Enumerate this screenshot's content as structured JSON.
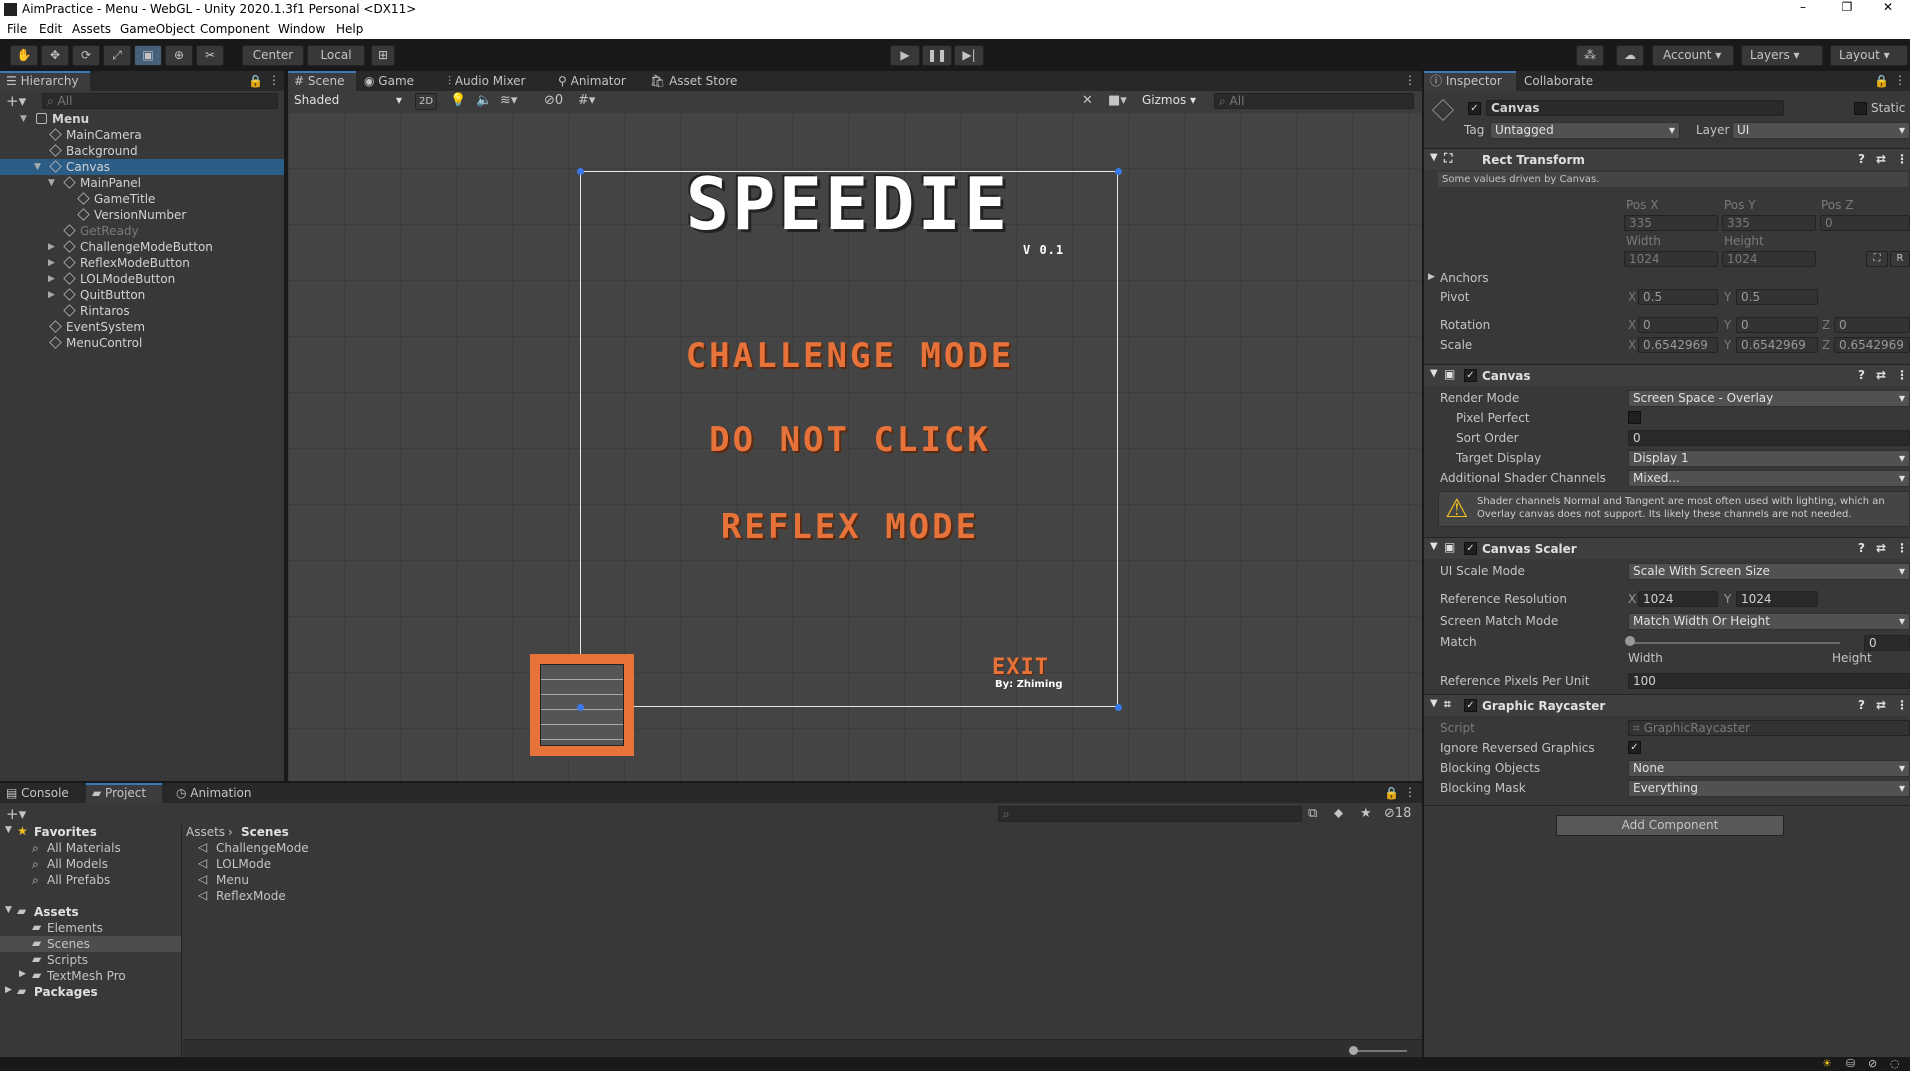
{
  "window": {
    "title": "AimPractice - Menu - WebGL - Unity 2020.1.3f1 Personal <DX11>"
  },
  "menubar": [
    "File",
    "Edit",
    "Assets",
    "GameObject",
    "Component",
    "Window",
    "Help"
  ],
  "toolbar": {
    "center": "Center",
    "local": "Local",
    "account": "Account",
    "layers": "Layers",
    "layout": "Layout"
  },
  "hierarchy": {
    "tab": "Hierarchy",
    "search_placeholder": "All",
    "items": [
      {
        "label": "Menu",
        "depth": 0,
        "expanded": true,
        "scene": true
      },
      {
        "label": "MainCamera",
        "depth": 1
      },
      {
        "label": "Background",
        "depth": 1
      },
      {
        "label": "Canvas",
        "depth": 1,
        "expanded": true,
        "selected": true
      },
      {
        "label": "MainPanel",
        "depth": 2,
        "expanded": true
      },
      {
        "label": "GameTitle",
        "depth": 3
      },
      {
        "label": "VersionNumber",
        "depth": 3
      },
      {
        "label": "GetReady",
        "depth": 2,
        "disabled": true
      },
      {
        "label": "ChallengeModeButton",
        "depth": 2,
        "collapsed": true
      },
      {
        "label": "ReflexModeButton",
        "depth": 2,
        "collapsed": true
      },
      {
        "label": "LOLModeButton",
        "depth": 2,
        "collapsed": true
      },
      {
        "label": "QuitButton",
        "depth": 2,
        "collapsed": true
      },
      {
        "label": "Rintaros",
        "depth": 2
      },
      {
        "label": "EventSystem",
        "depth": 1
      },
      {
        "label": "MenuControl",
        "depth": 1
      }
    ]
  },
  "scene_tabs": [
    "Scene",
    "Game",
    "Audio Mixer",
    "Animator",
    "Asset Store"
  ],
  "scene_toolbar": {
    "shading": "Shaded",
    "mode2d": "2D",
    "hidden_count": "0",
    "gizmos": "Gizmos",
    "search_placeholder": "All"
  },
  "game_ui": {
    "title": "SPEEDIE",
    "version": "V 0.1",
    "challenge": "CHALLENGE MODE",
    "donotclick": "DO NOT CLICK",
    "reflex": "REFLEX MODE",
    "exit": "EXIT",
    "by": "By: Zhiming"
  },
  "bottom_tabs": [
    "Console",
    "Project",
    "Animation"
  ],
  "project": {
    "hidden_count": "18",
    "favorites_label": "Favorites",
    "favorites": [
      "All Materials",
      "All Models",
      "All Prefabs"
    ],
    "assets_label": "Assets",
    "asset_folders": [
      "Elements",
      "Scenes",
      "Scripts",
      "TextMesh Pro"
    ],
    "packages_label": "Packages",
    "breadcrumb": [
      "Assets",
      "Scenes"
    ],
    "files": [
      "ChallengeMode",
      "LOLMode",
      "Menu",
      "ReflexMode"
    ]
  },
  "inspector": {
    "tabs": [
      "Inspector",
      "Collaborate"
    ],
    "object_name": "Canvas",
    "static": "Static",
    "tag_label": "Tag",
    "tag": "Untagged",
    "layer_label": "Layer",
    "layer": "UI",
    "rect": {
      "header": "Rect Transform",
      "note": "Some values driven by Canvas.",
      "posx_l": "Pos X",
      "posy_l": "Pos Y",
      "posz_l": "Pos Z",
      "posx": "335",
      "posy": "335",
      "posz": "0",
      "w_l": "Width",
      "h_l": "Height",
      "w": "1024",
      "h": "1024",
      "r_btn": "R",
      "anchors": "Anchors",
      "pivot": "Pivot",
      "pivx": "0.5",
      "pivy": "0.5",
      "rotation": "Rotation",
      "rotx": "0",
      "roty": "0",
      "rotz": "0",
      "scale": "Scale",
      "scx": "0.6542969",
      "scy": "0.6542969",
      "scz": "0.6542969",
      "x": "X",
      "y": "Y",
      "z": "Z"
    },
    "canvas": {
      "header": "Canvas",
      "render_mode_l": "Render Mode",
      "render_mode": "Screen Space - Overlay",
      "pixel_perfect": "Pixel Perfect",
      "sort_order_l": "Sort Order",
      "sort_order": "0",
      "target_display_l": "Target Display",
      "target_display": "Display 1",
      "shader_channels_l": "Additional Shader Channels",
      "shader_channels": "Mixed...",
      "warning": "Shader channels Normal and Tangent are most often used with lighting, which an Overlay canvas does not support. Its likely these channels are not needed."
    },
    "scaler": {
      "header": "Canvas Scaler",
      "ui_scale_l": "UI Scale Mode",
      "ui_scale": "Scale With Screen Size",
      "refres_l": "Reference Resolution",
      "refx": "1024",
      "refy": "1024",
      "match_mode_l": "Screen Match Mode",
      "match_mode": "Match Width Or Height",
      "match_l": "Match",
      "match": "0",
      "match_fraction": 0,
      "width_l": "Width",
      "height_l": "Height",
      "ppu_l": "Reference Pixels Per Unit",
      "ppu": "100"
    },
    "raycaster": {
      "header": "Graphic Raycaster",
      "script_l": "Script",
      "script": "GraphicRaycaster",
      "ignore_l": "Ignore Reversed Graphics",
      "blocking_l": "Blocking Objects",
      "blocking": "None",
      "mask_l": "Blocking Mask",
      "mask": "Everything"
    },
    "add_component": "Add Component"
  },
  "colors": {
    "accent_orange": "#e8733a",
    "selection_blue": "#2c5d87"
  }
}
